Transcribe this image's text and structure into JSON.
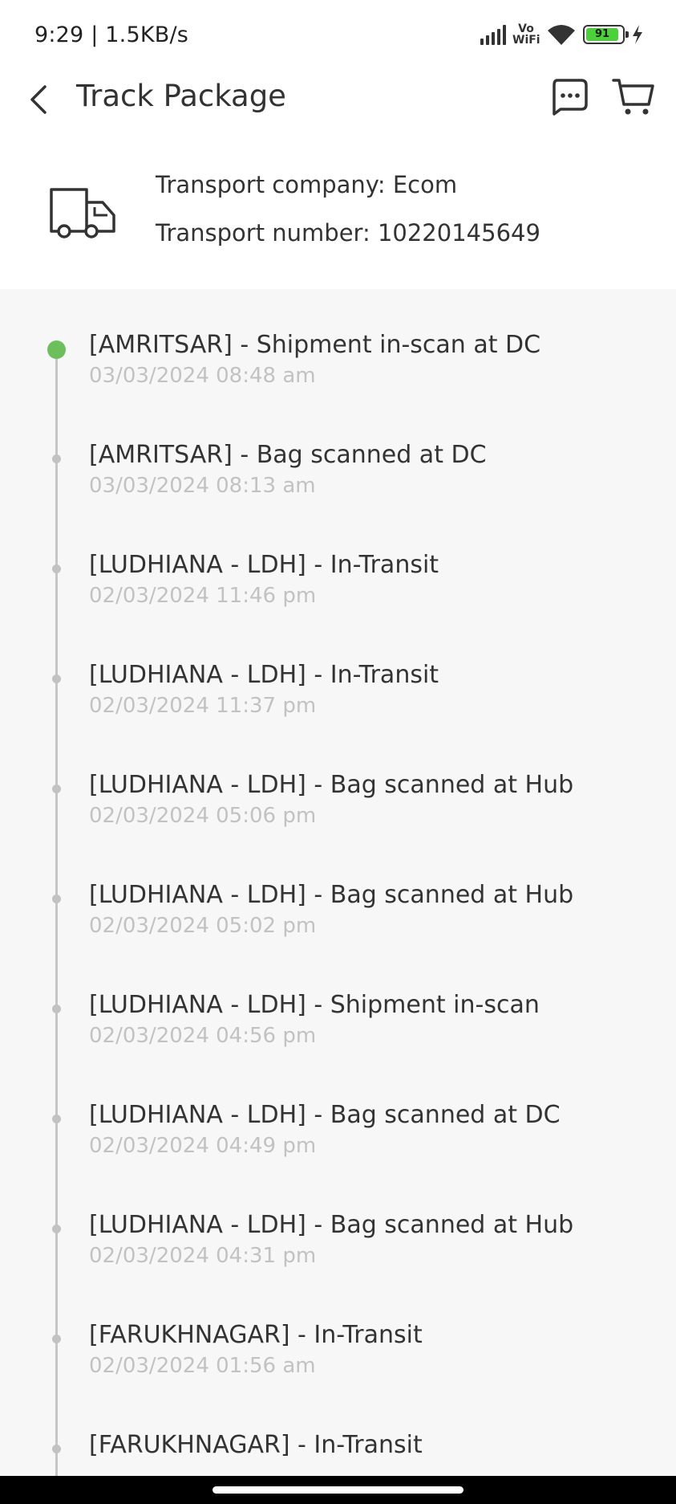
{
  "status_bar": {
    "time": "9:29 | 1.5KB/s",
    "vowifi_top": "Vo",
    "vowifi_bottom": "WiFi",
    "battery_level": "91",
    "battery_color": "#4cd13a",
    "icons": [
      "signal-icon",
      "vowifi-icon",
      "wifi-icon",
      "battery-icon",
      "charging-icon"
    ]
  },
  "header": {
    "title": "Track Package",
    "icons": [
      "back-arrow-icon",
      "message-icon",
      "cart-icon"
    ]
  },
  "transport": {
    "company": "Transport company: Ecom",
    "number": "Transport number: 10220145649",
    "icon": "truck-icon"
  },
  "colors": {
    "active_dot": "#6cbf5b",
    "inactive_dot": "#c2c2c2",
    "timestamp_text": "#c2c2c2"
  },
  "events": [
    {
      "title": "[AMRITSAR] - Shipment in-scan at DC",
      "time": "03/03/2024 08:48 am",
      "active": true
    },
    {
      "title": "[AMRITSAR] - Bag scanned at DC",
      "time": "03/03/2024 08:13 am",
      "active": false
    },
    {
      "title": "[LUDHIANA - LDH] - In-Transit",
      "time": "02/03/2024 11:46 pm",
      "active": false
    },
    {
      "title": "[LUDHIANA - LDH] - In-Transit",
      "time": "02/03/2024 11:37 pm",
      "active": false
    },
    {
      "title": "[LUDHIANA - LDH] - Bag scanned at Hub",
      "time": "02/03/2024 05:06 pm",
      "active": false
    },
    {
      "title": "[LUDHIANA - LDH] - Bag scanned at Hub",
      "time": "02/03/2024 05:02 pm",
      "active": false
    },
    {
      "title": "[LUDHIANA - LDH] - Shipment in-scan",
      "time": "02/03/2024 04:56 pm",
      "active": false
    },
    {
      "title": "[LUDHIANA - LDH] - Bag scanned at DC",
      "time": "02/03/2024 04:49 pm",
      "active": false
    },
    {
      "title": "[LUDHIANA - LDH] - Bag scanned at Hub",
      "time": "02/03/2024 04:31 pm",
      "active": false
    },
    {
      "title": "[FARUKHNAGAR] - In-Transit",
      "time": "02/03/2024 01:56 am",
      "active": false
    },
    {
      "title": "[FARUKHNAGAR] - In-Transit",
      "time": "",
      "active": false
    }
  ]
}
